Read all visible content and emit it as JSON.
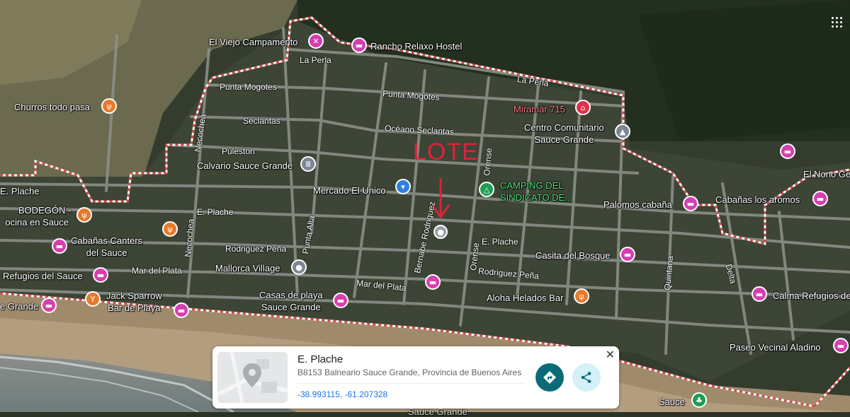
{
  "map": {
    "annotation": "LOTE",
    "places": [
      {
        "name": "El Viejo Campamento",
        "type": "food"
      },
      {
        "name": "Rancho Relaxo Hostel",
        "type": "hotel"
      },
      {
        "name": "Churros todo pasa",
        "type": "food"
      },
      {
        "name": "Miramar 715",
        "type": "landmark"
      },
      {
        "name": "Centro Comunitario Sauce Grande",
        "type": "school"
      },
      {
        "name": "Calvario Sauce Grande",
        "type": "landmark"
      },
      {
        "name": "Mercado El Unico",
        "type": "shop"
      },
      {
        "name": "CAMPING DEL SINDICATO DE...",
        "type": "camping"
      },
      {
        "name": "BODEGÓN - Cocina en Sauce",
        "type": "food"
      },
      {
        "name": "Cabañas Canters del Sauce",
        "type": "hotel"
      },
      {
        "name": "Refugios del Sauce",
        "type": "hotel"
      },
      {
        "name": "Jack Sparrow Bar de Playa",
        "type": "bar"
      },
      {
        "name": "Mallorca Village",
        "type": "landmark"
      },
      {
        "name": "Casas de playa Sauce Grande",
        "type": "hotel"
      },
      {
        "name": "Palomos cabaña",
        "type": "hotel"
      },
      {
        "name": "Cabañas los aromos",
        "type": "hotel"
      },
      {
        "name": "El Nono Ge",
        "type": "hotel"
      },
      {
        "name": "Casita del Bosque",
        "type": "hotel"
      },
      {
        "name": "Aloha Helados Bar",
        "type": "food"
      },
      {
        "name": "Calma Refugios de",
        "type": "hotel"
      },
      {
        "name": "Paseo Vecinal Aladino",
        "type": "hotel"
      },
      {
        "name": "Sauce",
        "type": "park"
      },
      {
        "name": "E. Plache",
        "type": "street"
      },
      {
        "name": "e Grande",
        "type": "area"
      }
    ],
    "labels": {
      "viejo": "El Viejo Campamento",
      "rancho": "Rancho Relaxo Hostel",
      "churros": "Churros todo pasa",
      "miramar": "Miramar 715",
      "centro1": "Centro Comunitario",
      "centro2": "Sauce Grande",
      "calvario": "Calvario Sauce Grande",
      "mercado": "Mercado El Unico",
      "camping1": "CAMPING DEL",
      "camping2": "SINDICATO DE...",
      "bodegon1": "BODEGÓN -",
      "bodegon2": "ocina en Sauce",
      "canters1": "Cabañas Canters",
      "canters2": "del Sauce",
      "refugios": "Refugios del Sauce",
      "jack1": "Jack Sparrow",
      "jack2": "Bar de Playa",
      "mallorca": "Mallorca Village",
      "casas1": "Casas de playa",
      "casas2": "Sauce Grande",
      "palomos": "Palomos cabaña",
      "aromos": "Cabañas los aromos",
      "nono": "El Nono Ge",
      "casita": "Casita del Bosque",
      "aloha": "Aloha Helados Bar",
      "calma": "Calma Refugios de",
      "paseo": "Paseo Vecinal Aladino",
      "sauce": "Sauce",
      "plache_w": "E. Plache",
      "egrande": "e Grande",
      "sauce_bottom": "Sauce Grande"
    },
    "streets": {
      "la_perla_w": "La Perla",
      "la_perla_e": "La Perla",
      "punta_mogotes_w": "Punta Mogotes",
      "punta_mogotes_e": "Punta Mogotes",
      "seclantas_w": "Seclantas",
      "oceano_seclantas": "Océano Seclantas",
      "puleston": "Puleston",
      "necochea_n": "Necochea",
      "necochea_s": "Necochea",
      "e_plache_mid": "E. Plache",
      "e_plache_e": "E. Plache",
      "rodriguez_pena_w": "Rodriguez Peña",
      "rodriguez_pena_e": "Rodriguez Peña",
      "mar_del_plata_w": "Mar del Plata",
      "mar_del_plata_e": "Mar del Plata",
      "punta_alta": "Punta Alta",
      "bernabe": "Bernabe Rodriguez",
      "orense_n": "Orense",
      "orense_s": "Orense",
      "quintana": "Quintana",
      "delta": "Delta"
    }
  },
  "card": {
    "title": "E. Plache",
    "address": "B8153 Balneario Sauce Grande, Provincia de Buenos Aires",
    "coords": "-38.993115, -61.207328",
    "close": "✕"
  },
  "colors": {
    "hotel": "#d63fb0",
    "food": "#e8792b",
    "annotation": "#e0213a",
    "directions": "#0b6b78"
  }
}
